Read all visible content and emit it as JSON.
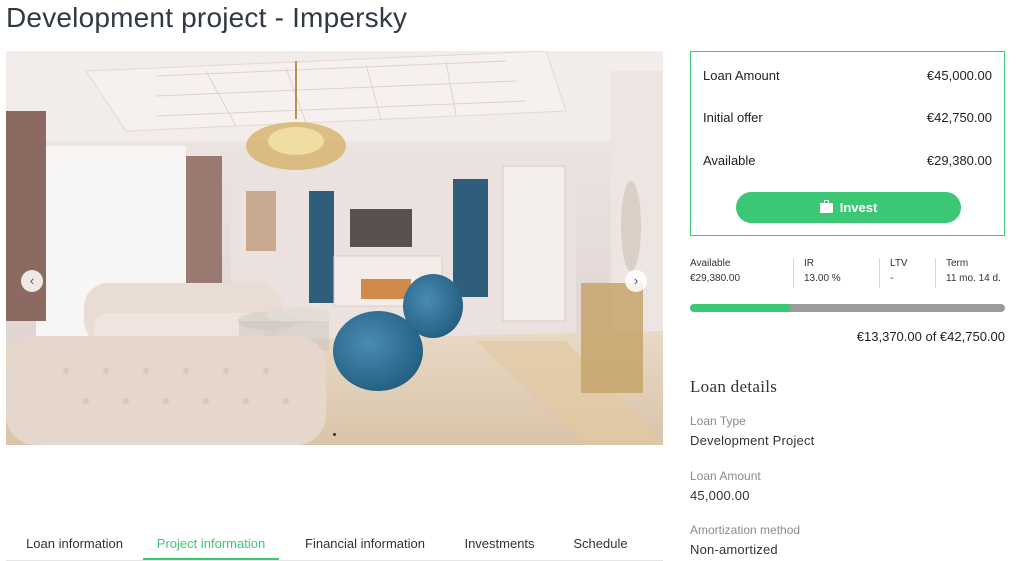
{
  "title": "Development project - Impersky",
  "gallery": {
    "prev_icon": "‹",
    "next_icon": "›"
  },
  "tabs": [
    {
      "label": "Loan information",
      "active": false
    },
    {
      "label": "Project information",
      "active": true
    },
    {
      "label": "Financial information",
      "active": false
    },
    {
      "label": "Investments",
      "active": false
    },
    {
      "label": "Schedule",
      "active": false
    }
  ],
  "summary": {
    "loan_amount_label": "Loan Amount",
    "loan_amount_value": "€45,000.00",
    "initial_offer_label": "Initial offer",
    "initial_offer_value": "€42,750.00",
    "available_label": "Available",
    "available_value": "€29,380.00",
    "invest_label": "Invest"
  },
  "stats": [
    {
      "label": "Available",
      "value": "€29,380.00"
    },
    {
      "label": "IR",
      "value": "13.00 %"
    },
    {
      "label": "LTV",
      "value": "-"
    },
    {
      "label": "Term",
      "value": "11 mo. 14 d."
    }
  ],
  "progress": {
    "fraction": 0.3127,
    "text": "€13,370.00 of €42,750.00"
  },
  "loan_details": {
    "heading": "Loan details",
    "items": [
      {
        "label": "Loan Type",
        "value": "Development Project"
      },
      {
        "label": "Loan Amount",
        "value": "45,000.00"
      },
      {
        "label": "Amortization method",
        "value": "Non-amortized"
      }
    ]
  },
  "colors": {
    "accent": "#3cc774",
    "progress_track": "#9b9b9b"
  }
}
